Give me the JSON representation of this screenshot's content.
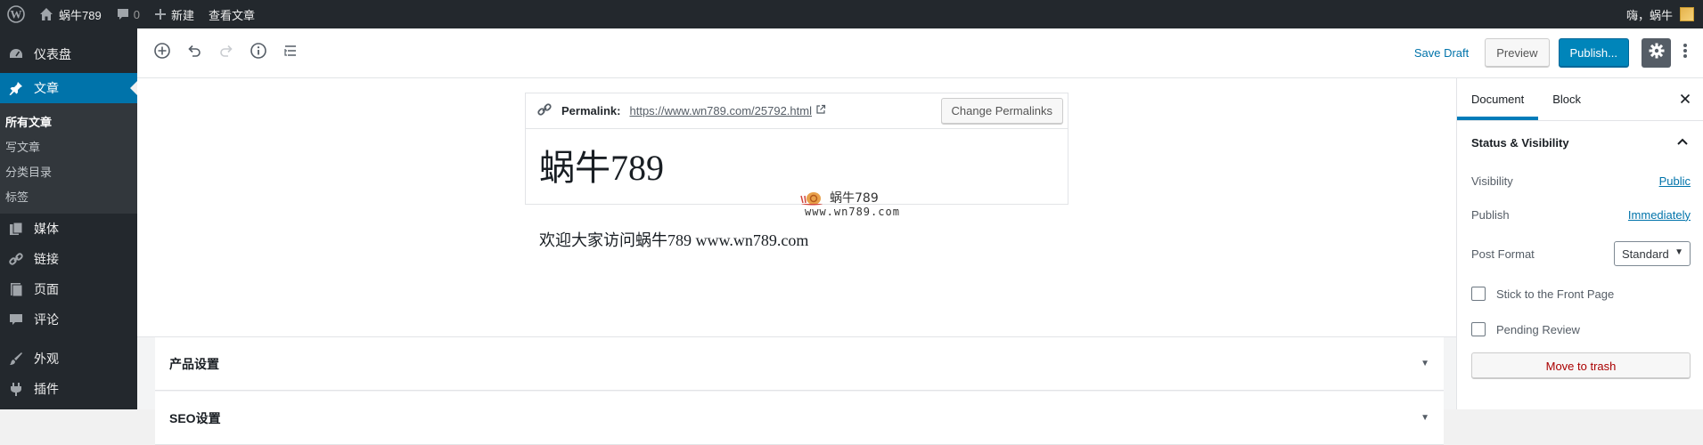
{
  "admin_bar": {
    "site_name": "蜗牛789",
    "comment_count": "0",
    "new_label": "新建",
    "view_post_label": "查看文章",
    "greeting": "嗨，蜗牛"
  },
  "sidebar": {
    "items": [
      {
        "label": "仪表盘",
        "icon": "dashboard-icon"
      },
      {
        "label": "文章",
        "icon": "pin-icon",
        "current": true
      },
      {
        "label": "媒体",
        "icon": "media-icon"
      },
      {
        "label": "链接",
        "icon": "link-icon"
      },
      {
        "label": "页面",
        "icon": "page-icon"
      },
      {
        "label": "评论",
        "icon": "comment-icon"
      },
      {
        "label": "外观",
        "icon": "brush-icon"
      },
      {
        "label": "插件",
        "icon": "plugin-icon"
      }
    ],
    "submenu": [
      "所有文章",
      "写文章",
      "分类目录",
      "标签"
    ]
  },
  "header": {
    "save_draft": "Save Draft",
    "preview": "Preview",
    "publish": "Publish..."
  },
  "editor": {
    "permalink_label": "Permalink:",
    "permalink_url": "https://www.wn789.com/25792.html",
    "change_permalinks": "Change Permalinks",
    "title": "蜗牛789",
    "paragraph": "欢迎大家访问蜗牛789 www.wn789.com",
    "watermark_text": "蜗牛789",
    "watermark_url": "www.wn789.com"
  },
  "meta_boxes": [
    "产品设置",
    "SEO设置"
  ],
  "settings": {
    "tabs": [
      "Document",
      "Block"
    ],
    "panel_title": "Status & Visibility",
    "visibility_label": "Visibility",
    "visibility_value": "Public",
    "publish_label": "Publish",
    "publish_value": "Immediately",
    "post_format_label": "Post Format",
    "post_format_value": "Standard",
    "stick_label": "Stick to the Front Page",
    "pending_label": "Pending Review",
    "trash_label": "Move to trash"
  },
  "colors": {
    "admin_bar": "#23282d",
    "accent": "#0073aa",
    "publish_button": "#0085ba",
    "trash_text": "#aa0000"
  }
}
